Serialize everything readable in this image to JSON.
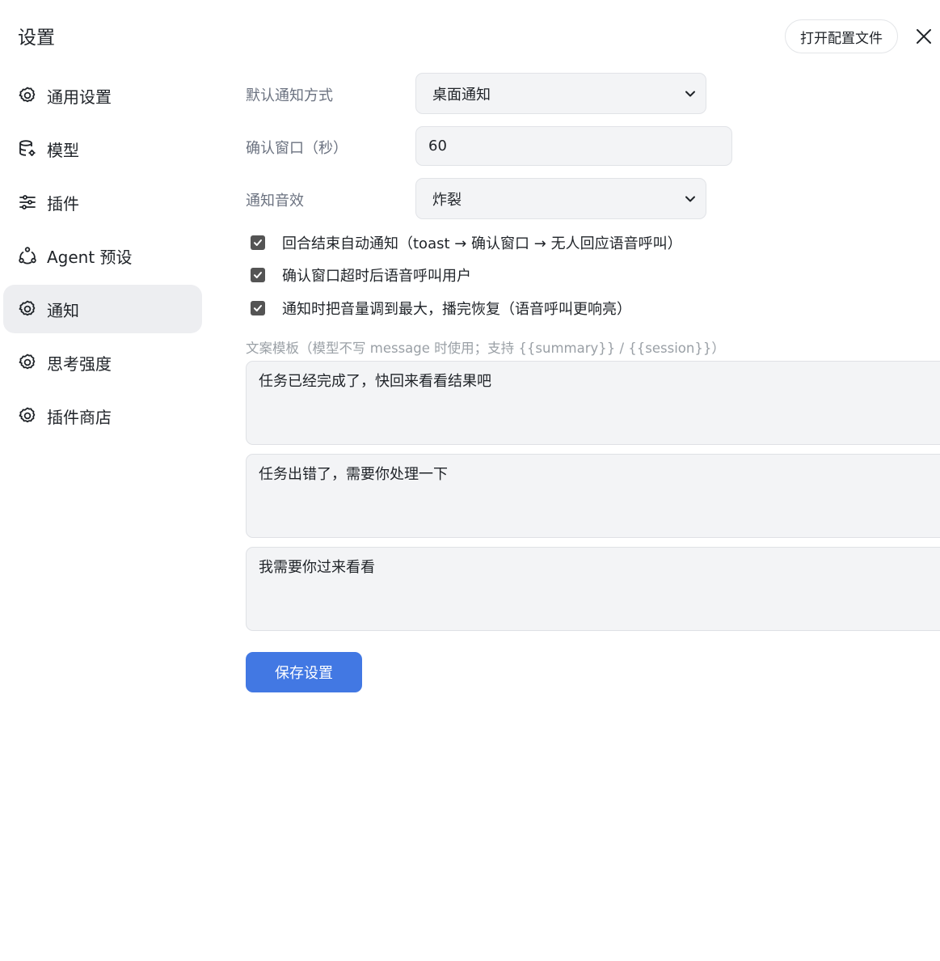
{
  "header": {
    "title": "设置",
    "open_config_label": "打开配置文件"
  },
  "sidebar": {
    "items": [
      {
        "label": "通用设置",
        "icon": "gear-icon",
        "active": false
      },
      {
        "label": "模型",
        "icon": "database-gear-icon",
        "active": false
      },
      {
        "label": "插件",
        "icon": "sliders-icon",
        "active": false
      },
      {
        "label": "Agent 预设",
        "icon": "share-nodes-icon",
        "active": false
      },
      {
        "label": "通知",
        "icon": "gear-icon",
        "active": true
      },
      {
        "label": "思考强度",
        "icon": "gear-icon",
        "active": false
      },
      {
        "label": "插件商店",
        "icon": "gear-icon",
        "active": false
      }
    ]
  },
  "notify": {
    "method_label": "默认通知方式",
    "method_value": "桌面通知",
    "confirm_window_label": "确认窗口（秒）",
    "confirm_window_value": "60",
    "sound_label": "通知音效",
    "sound_value": "炸裂",
    "checkboxes": [
      {
        "label": "回合结束自动通知（toast → 确认窗口 → 无人回应语音呼叫）",
        "checked": true
      },
      {
        "label": "确认窗口超时后语音呼叫用户",
        "checked": true
      },
      {
        "label": "通知时把音量调到最大，播完恢复（语音呼叫更响亮）",
        "checked": true
      }
    ],
    "template_label": "文案模板（模型不写 message 时使用；支持 {{summary}} / {{session}}）",
    "templates": [
      "任务已经完成了，快回来看看结果吧",
      "任务出错了，需要你处理一下",
      "我需要你过来看看"
    ],
    "save_label": "保存设置"
  },
  "colors": {
    "accent": "#4278e3",
    "active_nav_bg": "#edeef1",
    "field_bg": "#f3f4f6"
  }
}
